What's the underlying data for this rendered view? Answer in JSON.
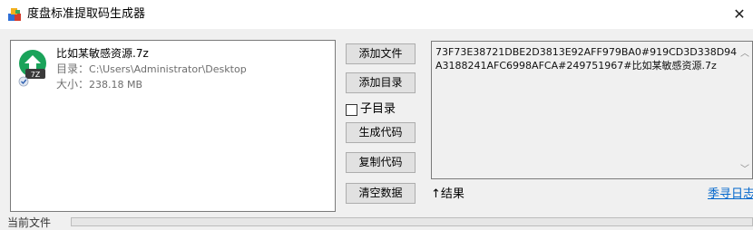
{
  "window": {
    "title": "度盘标准提取码生成器",
    "close_glyph": "✕",
    "app_icon": "colored-blocks-icon"
  },
  "file_list": {
    "items": [
      {
        "name": "比如某敏感资源.7z",
        "dir_label": "目录：",
        "dir_value": "C:\\Users\\Administrator\\Desktop",
        "size_label": "大小：",
        "size_value": "238.18 MB",
        "icon": "7z-archive-icon",
        "icon_badge": "7Z"
      }
    ]
  },
  "buttons": {
    "add_file": "添加文件",
    "add_dir": "添加目录",
    "generate": "生成代码",
    "copy": "复制代码",
    "clear": "清空数据"
  },
  "subdir_checkbox": {
    "label": "子目录",
    "checked": false
  },
  "result": {
    "text": "73F73E38721DBE2D3813E92AFF979BA0#919CD3D338D94A3188241AFC6998AFCA#249751967#比如某敏感资源.7z",
    "label": "↑结果",
    "scroll_up": "︿",
    "scroll_down": "﹀"
  },
  "blog_link": "季寻日志",
  "status": {
    "label": "当前文件"
  },
  "colors": {
    "link": "#0066cc",
    "icon_green": "#1aa35a",
    "icon_dark": "#3a3a3a"
  }
}
